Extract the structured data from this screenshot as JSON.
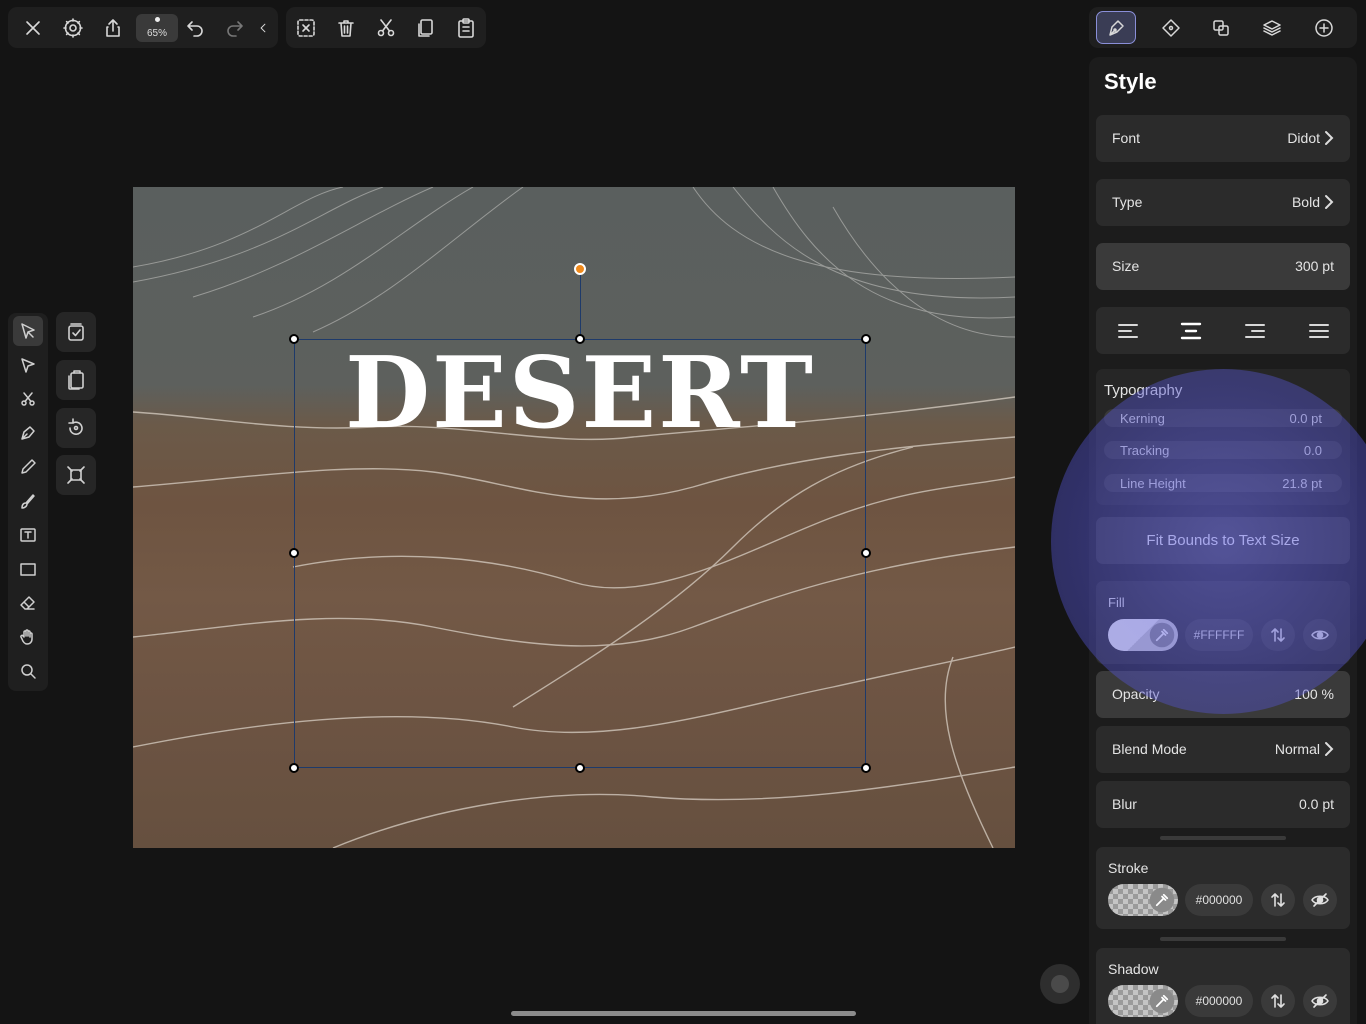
{
  "toolbar": {
    "zoom_label": "65%",
    "buttons": [
      "close-icon",
      "gear-icon",
      "share-icon",
      "undo-icon",
      "redo-icon",
      "chevron-left-icon",
      "deselect-icon",
      "trash-icon",
      "cut-icon",
      "copy-icon",
      "paste-icon"
    ]
  },
  "canvas": {
    "text": "DESERT"
  },
  "panel_tabs": [
    "style-brush-icon",
    "node-diamond-icon",
    "boolean-icon",
    "layers-icon",
    "add-icon"
  ],
  "style": {
    "title": "Style",
    "font_label": "Font",
    "font_value": "Didot",
    "type_label": "Type",
    "type_value": "Bold",
    "size_label": "Size",
    "size_value": "300 pt",
    "typography_label": "Typography",
    "kerning_label": "Kerning",
    "kerning_value": "0.0 pt",
    "tracking_label": "Tracking",
    "tracking_value": "0.0",
    "line_height_label": "Line Height",
    "line_height_value": "21.8 pt",
    "fit_button": "Fit Bounds to Text Size",
    "fill_label": "Fill",
    "fill_hex": "#FFFFFF",
    "opacity_label": "Opacity",
    "opacity_value": "100 %",
    "blend_label": "Blend Mode",
    "blend_value": "Normal",
    "blur_label": "Blur",
    "blur_value": "0.0 pt",
    "stroke_label": "Stroke",
    "stroke_hex": "#000000",
    "shadow_label": "Shadow",
    "shadow_hex": "#000000"
  },
  "colors": {
    "accent": "#8a8fd8",
    "rotation_handle": "#f08a1c",
    "selection_border": "#1e3a6a",
    "highlight_glow": "#6e6eeb"
  }
}
